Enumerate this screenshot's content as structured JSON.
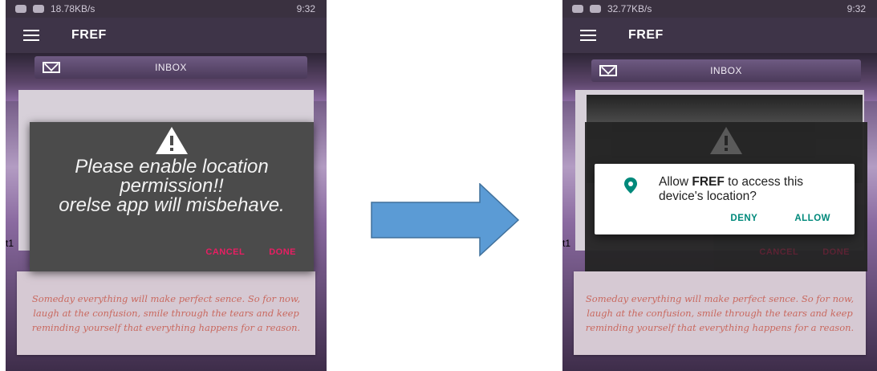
{
  "left_screen": {
    "status_text": "18.78KB/s",
    "status_time": "9:32",
    "app_title": "FREF",
    "inbox_label": "INBOX",
    "side_label": "t1",
    "dialog": {
      "message": "Please enable location permission!!\norelse app will misbehave.",
      "cancel_label": "CANCEL",
      "done_label": "DONE"
    },
    "quote": "Someday everything will make perfect sence. So for now, laugh at the confusion, smile through the tears and keep reminding yourself that everything happens for a reason."
  },
  "right_screen": {
    "status_text": "32.77KB/s",
    "status_time": "9:32",
    "app_title": "FREF",
    "inbox_label": "INBOX",
    "side_label": "t1",
    "background_dialog": {
      "cancel_label": "CANCEL",
      "done_label": "DONE"
    },
    "permission_dialog": {
      "prefix": "Allow ",
      "app_name": "FREF",
      "suffix": " to access this device's location?",
      "deny_label": "DENY",
      "allow_label": "ALLOW"
    },
    "quote": "Someday everything will make perfect sence. So for now, laugh at the confusion, smile through the tears and keep reminding yourself that everything happens for a reason."
  },
  "colors": {
    "accent_pink": "#e91e63",
    "teal": "#00897b",
    "arrow_fill": "#5b9bd5",
    "arrow_stroke": "#41719c"
  },
  "icons": [
    "menu-icon",
    "mail-icon",
    "warning-icon",
    "location-pin-icon",
    "right-arrow-icon"
  ]
}
